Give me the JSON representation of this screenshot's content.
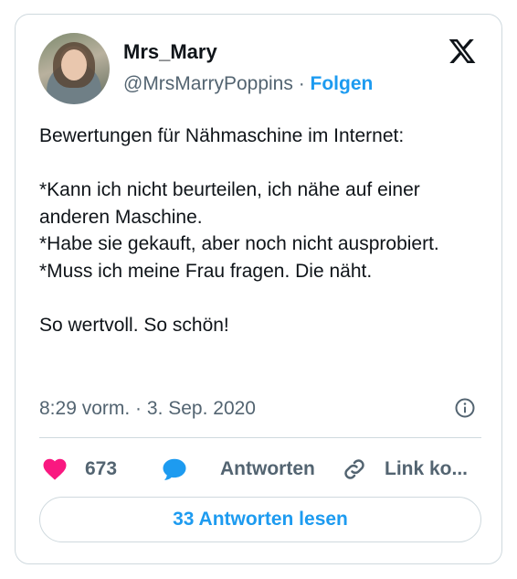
{
  "tweet": {
    "author_name": "Mrs_Mary",
    "handle": "@MrsMarryPoppins",
    "separator": " · ",
    "follow_label": "Folgen",
    "text": "Bewertungen für Nähmaschine im Internet:\n\n*Kann ich nicht beurteilen, ich nähe auf einer anderen Maschine.\n*Habe sie gekauft, aber noch nicht ausprobiert.\n*Muss ich meine Frau fragen. Die näht.\n\nSo wertvoll. So schön!",
    "time": "8:29 vorm.",
    "date": "3. Sep. 2020",
    "likes_count": "673",
    "reply_label": "Antworten",
    "copy_link_label": "Link ko...",
    "read_replies_label": "33 Antworten lesen"
  },
  "icons": {
    "brand": "x-logo-icon",
    "info": "info-icon",
    "like": "heart-icon",
    "reply": "speech-bubble-icon",
    "link": "link-icon"
  },
  "colors": {
    "accent": "#1d9bf0",
    "like": "#f91880",
    "secondary_text": "#536471",
    "border": "#cfd9de"
  }
}
